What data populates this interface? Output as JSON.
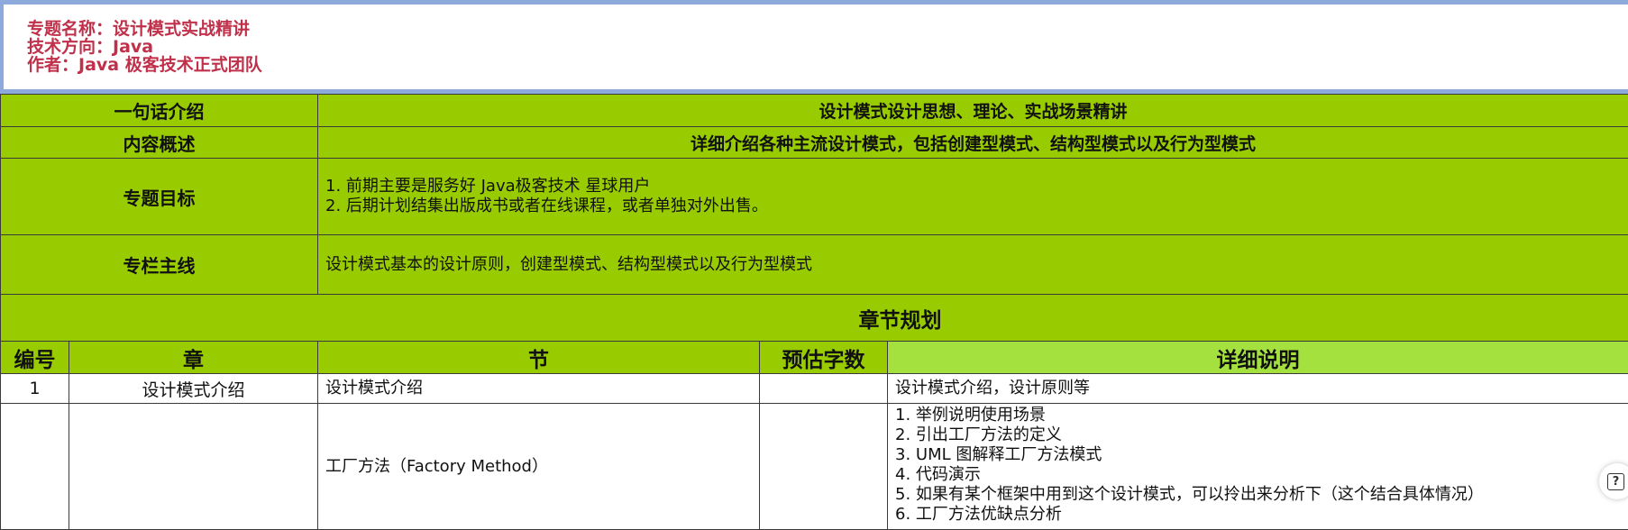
{
  "header": {
    "topic": "专题名称：设计模式实战精讲",
    "direction": "技术方向：Java",
    "author": "作者：Java 极客技术正式团队"
  },
  "intro": {
    "label": "一句话介绍",
    "value": "设计模式设计思想、理论、实战场景精讲"
  },
  "overview": {
    "label": "内容概述",
    "value": "详细介绍各种主流设计模式，包括创建型模式、结构型模式以及行为型模式"
  },
  "goals": {
    "label": "专题目标",
    "lines": [
      "1. 前期主要是服务好 Java极客技术 星球用户",
      "2. 后期计划结集出版成书或者在线课程，或者单独对外出售。"
    ]
  },
  "mainline": {
    "label": "专栏主线",
    "value": "设计模式基本的设计原则，创建型模式、结构型模式以及行为型模式"
  },
  "section_title": "章节规划",
  "columns": [
    "编号",
    "章",
    "节",
    "预估字数",
    "详细说明"
  ],
  "rows": [
    {
      "no": "1",
      "chapter": "设计模式介绍",
      "section": "设计模式介绍",
      "words": "",
      "details": [
        "设计模式介绍，设计原则等"
      ]
    },
    {
      "no": "",
      "chapter": "",
      "section": "工厂方法（Factory Method）",
      "words": "",
      "details": [
        "1. 举例说明使用场景",
        "2. 引出工厂方法的定义",
        "3. UML 图解释工厂方法模式",
        "4. 代码演示",
        "5. 如果有某个框架中用到这个设计模式，可以拎出来分析下（这个结合具体情况）",
        "6. 工厂方法优缺点分析"
      ]
    }
  ],
  "help": {
    "icon": "help-icon",
    "glyph": "?"
  },
  "colors": {
    "green": "#99cc00",
    "light_green": "#a4e13f",
    "header_text": "#c0304a",
    "header_border": "#8ea9db"
  }
}
